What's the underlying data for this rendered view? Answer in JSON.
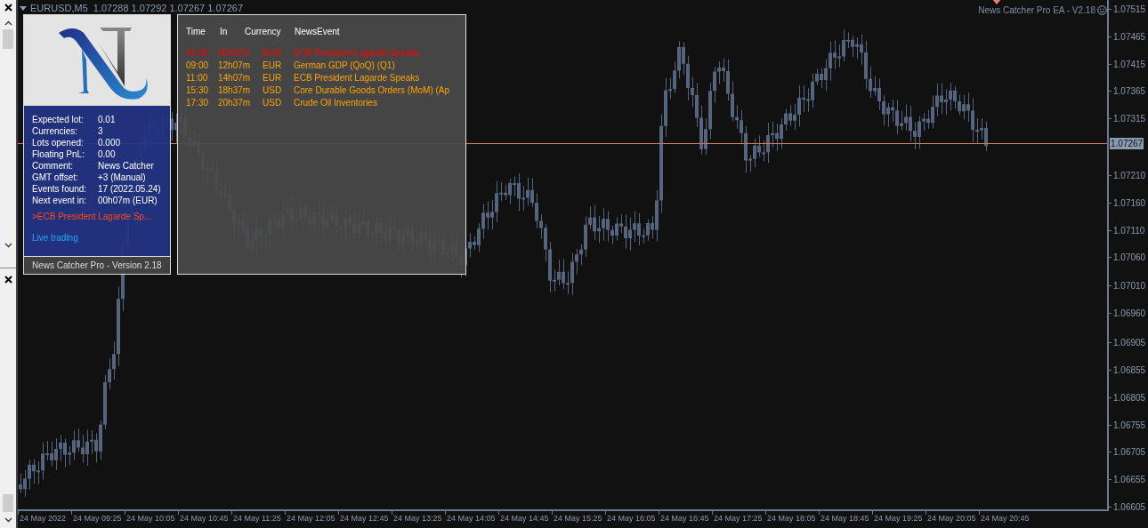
{
  "chart": {
    "symbol": "EURUSD,M5",
    "quotes": "1.07288 1.07292 1.07267 1.07267",
    "ea_label": "News Catcher Pro EA - V2.18",
    "price_labels": [
      "1.07515",
      "1.07465",
      "1.07415",
      "1.07365",
      "1.07315",
      "1.07210",
      "1.07160",
      "1.07110",
      "1.07060",
      "1.07010",
      "1.06960",
      "1.06905",
      "1.06855",
      "1.06805",
      "1.06755",
      "1.06705",
      "1.06655",
      "1.06605"
    ],
    "current_price": "1.07267",
    "time_labels": [
      "24 May 2022",
      "24 May 09:25",
      "24 May 10:05",
      "24 May 10:45",
      "24 May 11:25",
      "24 May 12:05",
      "24 May 12:45",
      "24 May 13:25",
      "24 May 14:05",
      "24 May 14:45",
      "24 May 15:25",
      "24 May 16:05",
      "24 May 16:45",
      "24 May 17:25",
      "24 May 18:05",
      "24 May 18:45",
      "24 May 19:25",
      "24 May 20:05",
      "24 May 20:45"
    ]
  },
  "info_panel": {
    "rows": [
      {
        "label": "Expected lot:",
        "value": "0.01"
      },
      {
        "label": "Currencies:",
        "value": "3"
      },
      {
        "label": "Lots opened:",
        "value": "0.000"
      },
      {
        "label": "Floating PnL:",
        "value": "0.00"
      },
      {
        "label": "Comment:",
        "value": "News Catcher"
      },
      {
        "label": "GMT offset:",
        "value": "+3 (Manual)"
      },
      {
        "label": "Events found:",
        "value": "17 (2022.05.24)"
      },
      {
        "label": "Next event in:",
        "value": "00h07m (EUR)"
      }
    ],
    "next_event": ">ECB President Lagarde Sp...",
    "status": "Live trading",
    "footer": "News Catcher Pro - Version 2.18"
  },
  "news_table": {
    "columns": [
      "Time",
      "In",
      "Currency",
      "NewsEvent"
    ],
    "rows": [
      {
        "time": "21:00",
        "in": "00h07m",
        "currency": "EUR",
        "event": "ECB President Lagarde Speaks",
        "imminent": true
      },
      {
        "time": "09:00",
        "in": "12h07m",
        "currency": "EUR",
        "event": "German GDP (QoQ) (Q1)",
        "imminent": false
      },
      {
        "time": "11:00",
        "in": "14h07m",
        "currency": "EUR",
        "event": "ECB President Lagarde Speaks",
        "imminent": false
      },
      {
        "time": "15:30",
        "in": "18h37m",
        "currency": "USD",
        "event": "Core Durable Goods Orders (MoM) (Ap",
        "imminent": false
      },
      {
        "time": "17:30",
        "in": "20h37m",
        "currency": "USD",
        "event": "Crude Oil Inventories",
        "imminent": false
      }
    ]
  }
}
